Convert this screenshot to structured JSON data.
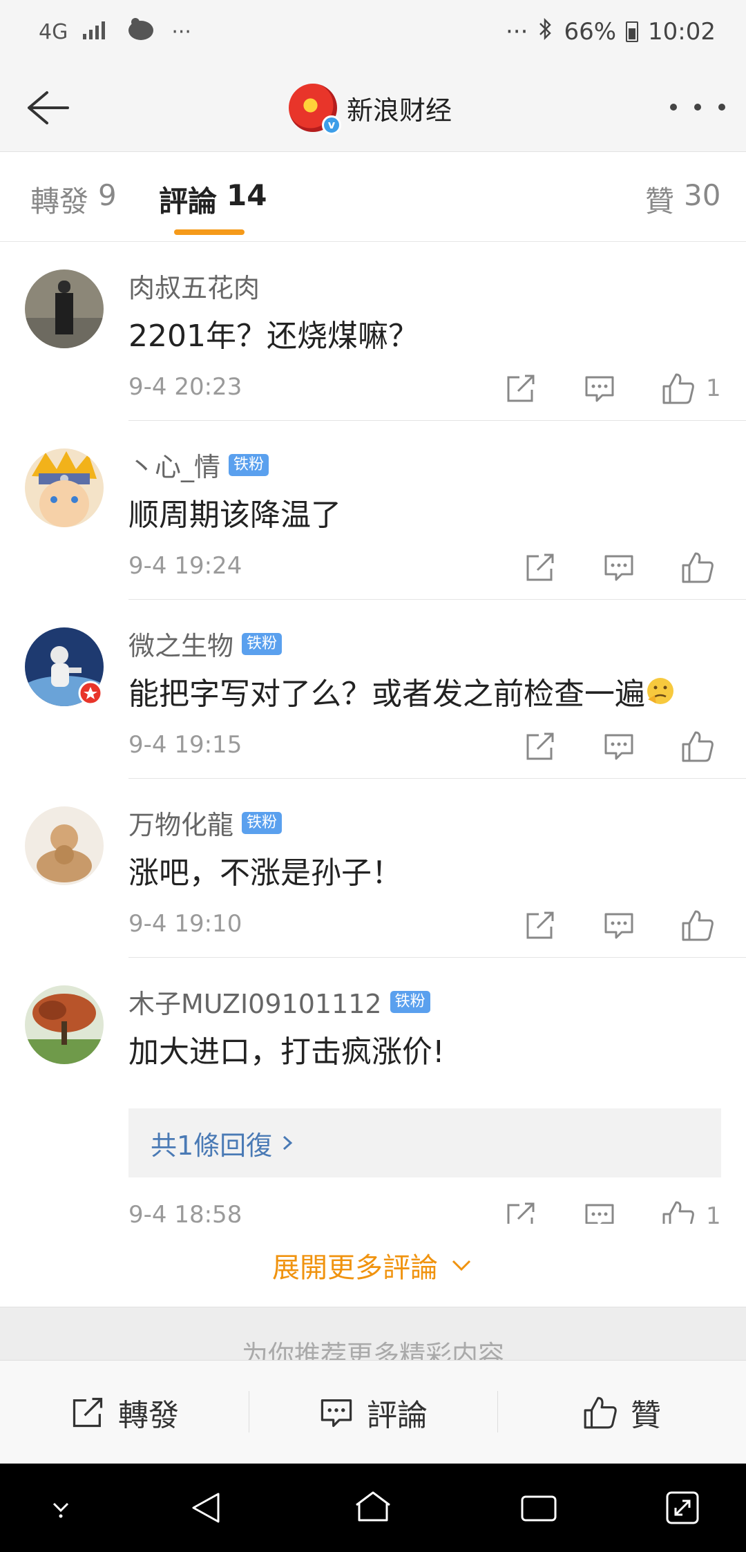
{
  "status": {
    "network": "4G",
    "dots": "···",
    "battery": "66%",
    "time": "10:02"
  },
  "header": {
    "title": "新浪财经",
    "verified_mark": "v"
  },
  "tabs": {
    "repost_label": "轉發",
    "repost_count": "9",
    "comment_label": "評論",
    "comment_count": "14",
    "like_label": "贊",
    "like_count": "30"
  },
  "comments": [
    {
      "name": "肉叔五花肉",
      "badge": "",
      "text": "2201年？还烧煤嘛？",
      "time": "9-4 20:23",
      "likes": "1"
    },
    {
      "name": "丶心_情",
      "badge": "铁粉",
      "text": "顺周期该降温了",
      "time": "9-4 19:24",
      "likes": ""
    },
    {
      "name": "微之生物",
      "badge": "铁粉",
      "text": "能把字写对了么？或者发之前检查一遍",
      "time": "9-4 19:15",
      "likes": ""
    },
    {
      "name": "万物化龍",
      "badge": "铁粉",
      "text": "涨吧，不涨是孙子！",
      "time": "9-4 19:10",
      "likes": ""
    },
    {
      "name": "木子MUZI09101112",
      "badge": "铁粉",
      "text": "加大进口，打击疯涨价!",
      "time": "9-4 18:58",
      "likes": "1",
      "reply_summary": "共1條回復"
    }
  ],
  "expand_more": "展開更多評論",
  "recommend_text": "为你推荐更多精彩内容",
  "bottom_bar": {
    "repost": "轉發",
    "comment": "評論",
    "like": "贊"
  },
  "colors": {
    "accent": "#f59a1a",
    "badge": "#5aa0ee",
    "link": "#4a7ab5"
  }
}
